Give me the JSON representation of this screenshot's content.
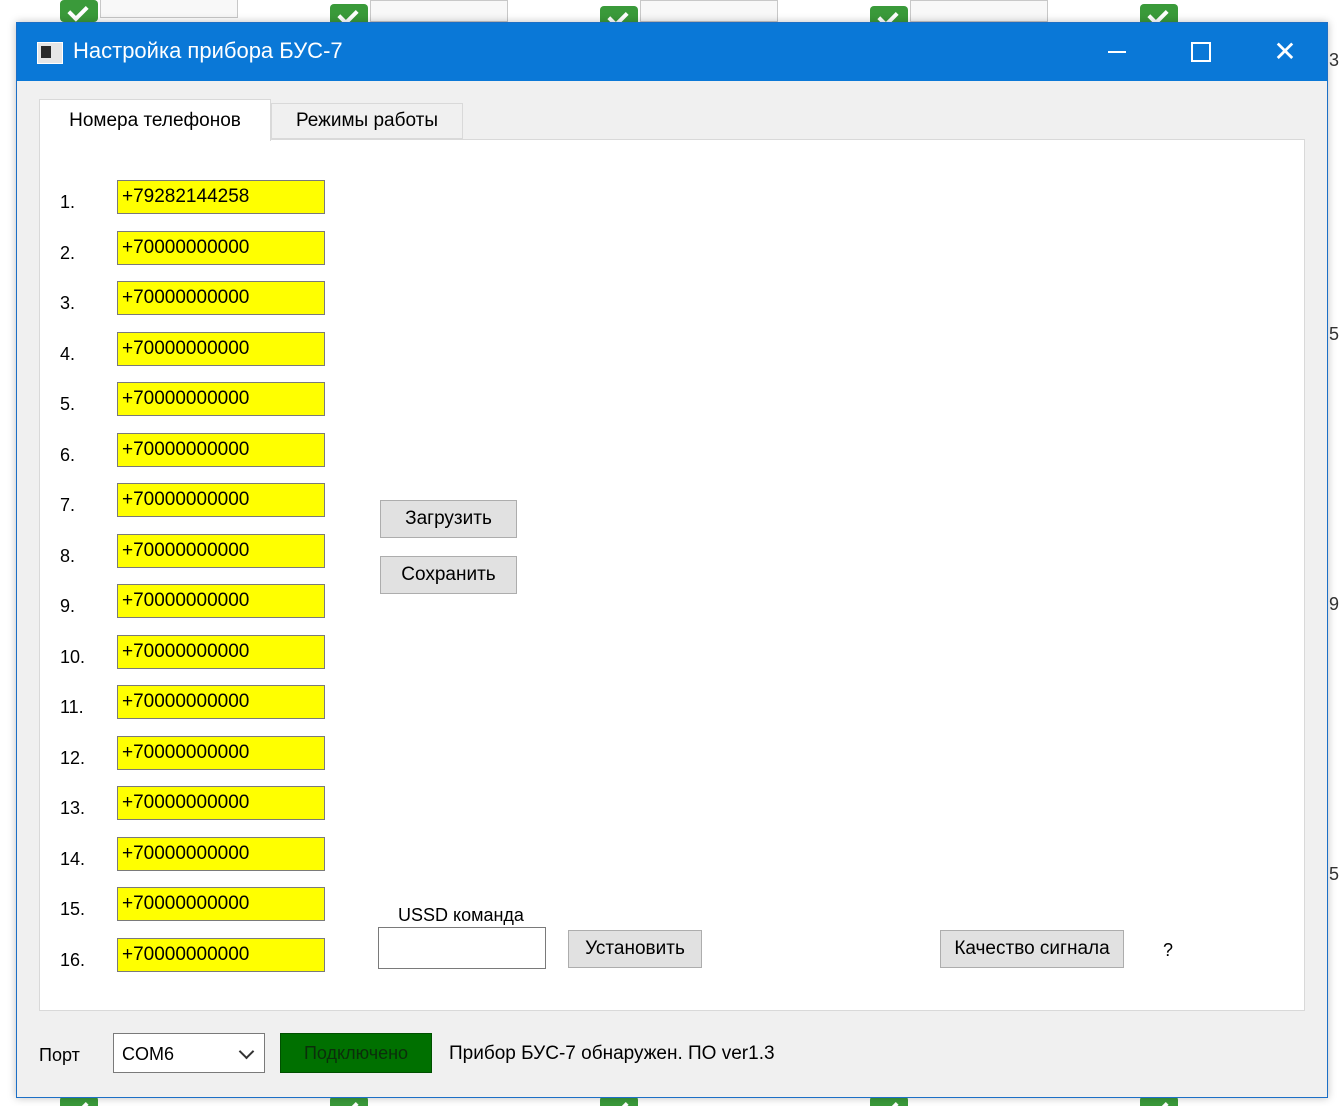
{
  "window": {
    "title": "Настройка прибора БУС-7",
    "controls": {
      "minimize": "—",
      "maximize": "☐",
      "close": "✕"
    }
  },
  "tabs": [
    {
      "label": "Номера телефонов",
      "active": true
    },
    {
      "label": "Режимы работы",
      "active": false
    }
  ],
  "phones": [
    {
      "index": "1.",
      "value": "+79282144258"
    },
    {
      "index": "2.",
      "value": "+70000000000"
    },
    {
      "index": "3.",
      "value": "+70000000000"
    },
    {
      "index": "4.",
      "value": "+70000000000"
    },
    {
      "index": "5.",
      "value": "+70000000000"
    },
    {
      "index": "6.",
      "value": "+70000000000"
    },
    {
      "index": "7.",
      "value": "+70000000000"
    },
    {
      "index": "8.",
      "value": "+70000000000"
    },
    {
      "index": "9.",
      "value": "+70000000000"
    },
    {
      "index": "10.",
      "value": "+70000000000"
    },
    {
      "index": "11.",
      "value": "+70000000000"
    },
    {
      "index": "12.",
      "value": "+70000000000"
    },
    {
      "index": "13.",
      "value": "+70000000000"
    },
    {
      "index": "14.",
      "value": "+70000000000"
    },
    {
      "index": "15.",
      "value": "+70000000000"
    },
    {
      "index": "16.",
      "value": "+70000000000"
    }
  ],
  "actions": {
    "load_label": "Загрузить",
    "save_label": "Сохранить"
  },
  "ussd": {
    "label": "USSD команда",
    "value": "",
    "set_label": "Установить"
  },
  "signal": {
    "button_label": "Качество сигнала",
    "value": "?"
  },
  "status_bar": {
    "port_label": "Порт",
    "port_value": "COM6",
    "connect_label": "Подключено",
    "status_text": "Прибор БУС-7 обнаружен. ПО ver1.3"
  },
  "background": {
    "edge_chars": [
      "3",
      "5",
      "9",
      "5"
    ]
  },
  "colors": {
    "titlebar": "#0a78d7",
    "phone_field": "#ffff00",
    "connected": "#007000"
  }
}
